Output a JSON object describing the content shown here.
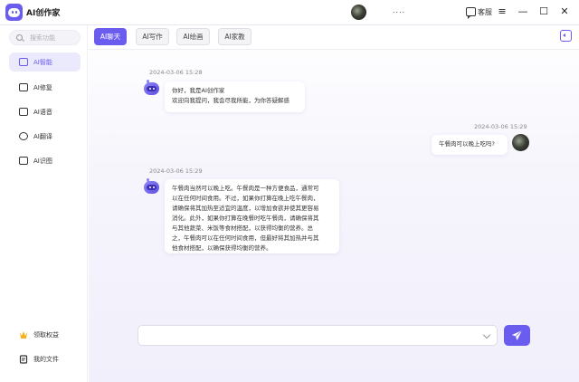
{
  "app": {
    "title": "AI创作家",
    "user_name": "....",
    "customer_service_label": "客服"
  },
  "window": {
    "menu_icon": "≡",
    "minimize_icon": "—",
    "maximize_icon": "☐",
    "close_icon": "✕"
  },
  "sidebar": {
    "search_placeholder": "搜索功能",
    "items": [
      {
        "label": "AI智能",
        "icon": "robot-icon",
        "active": true
      },
      {
        "label": "AI修复",
        "icon": "repair-icon",
        "active": false
      },
      {
        "label": "AI语音",
        "icon": "voice-icon",
        "active": false
      },
      {
        "label": "AI翻译",
        "icon": "translate-icon",
        "active": false
      },
      {
        "label": "AI识图",
        "icon": "image-recognition-icon",
        "active": false
      }
    ],
    "bottom": [
      {
        "label": "领取权益",
        "icon": "crown-icon"
      },
      {
        "label": "我的文件",
        "icon": "file-icon"
      }
    ]
  },
  "tabs": [
    {
      "label": "AI聊天",
      "active": true
    },
    {
      "label": "AI写作",
      "active": false
    },
    {
      "label": "AI绘画",
      "active": false
    },
    {
      "label": "AI家教",
      "active": false
    }
  ],
  "chat": {
    "messages": [
      {
        "sender": "bot",
        "time": "2024-03-06 15:28",
        "lines": [
          "你好，我是AI创作家",
          "欢迎向我提问，我会尽我所能，为你答疑解惑"
        ]
      },
      {
        "sender": "user",
        "time": "2024-03-06 15:29",
        "lines": [
          "午餐肉可以晚上吃吗?"
        ]
      },
      {
        "sender": "bot",
        "time": "2024-03-06 15:29",
        "lines": [
          "午餐肉当然可以晚上吃。午餐肉是一种方便食品，通常可",
          "以在任何时间食用。不过，如果你打算在晚上吃午餐肉，",
          "请确保将其加热至适宜的温度，以增加食欲并使其更容易",
          "消化。此外，如果你打算在晚餐时吃午餐肉，请确保将其",
          "与其他蔬菜、米饭等食材搭配，以获得均衡的营养。总",
          "之，午餐肉可以在任何时间食用，但最好将其加热并与其",
          "他食材搭配，以确保获得均衡的营养。"
        ]
      }
    ]
  },
  "input": {
    "placeholder": ""
  },
  "colors": {
    "accent": "#6b5cf0",
    "active_nav_bg": "#ebe9fc"
  }
}
